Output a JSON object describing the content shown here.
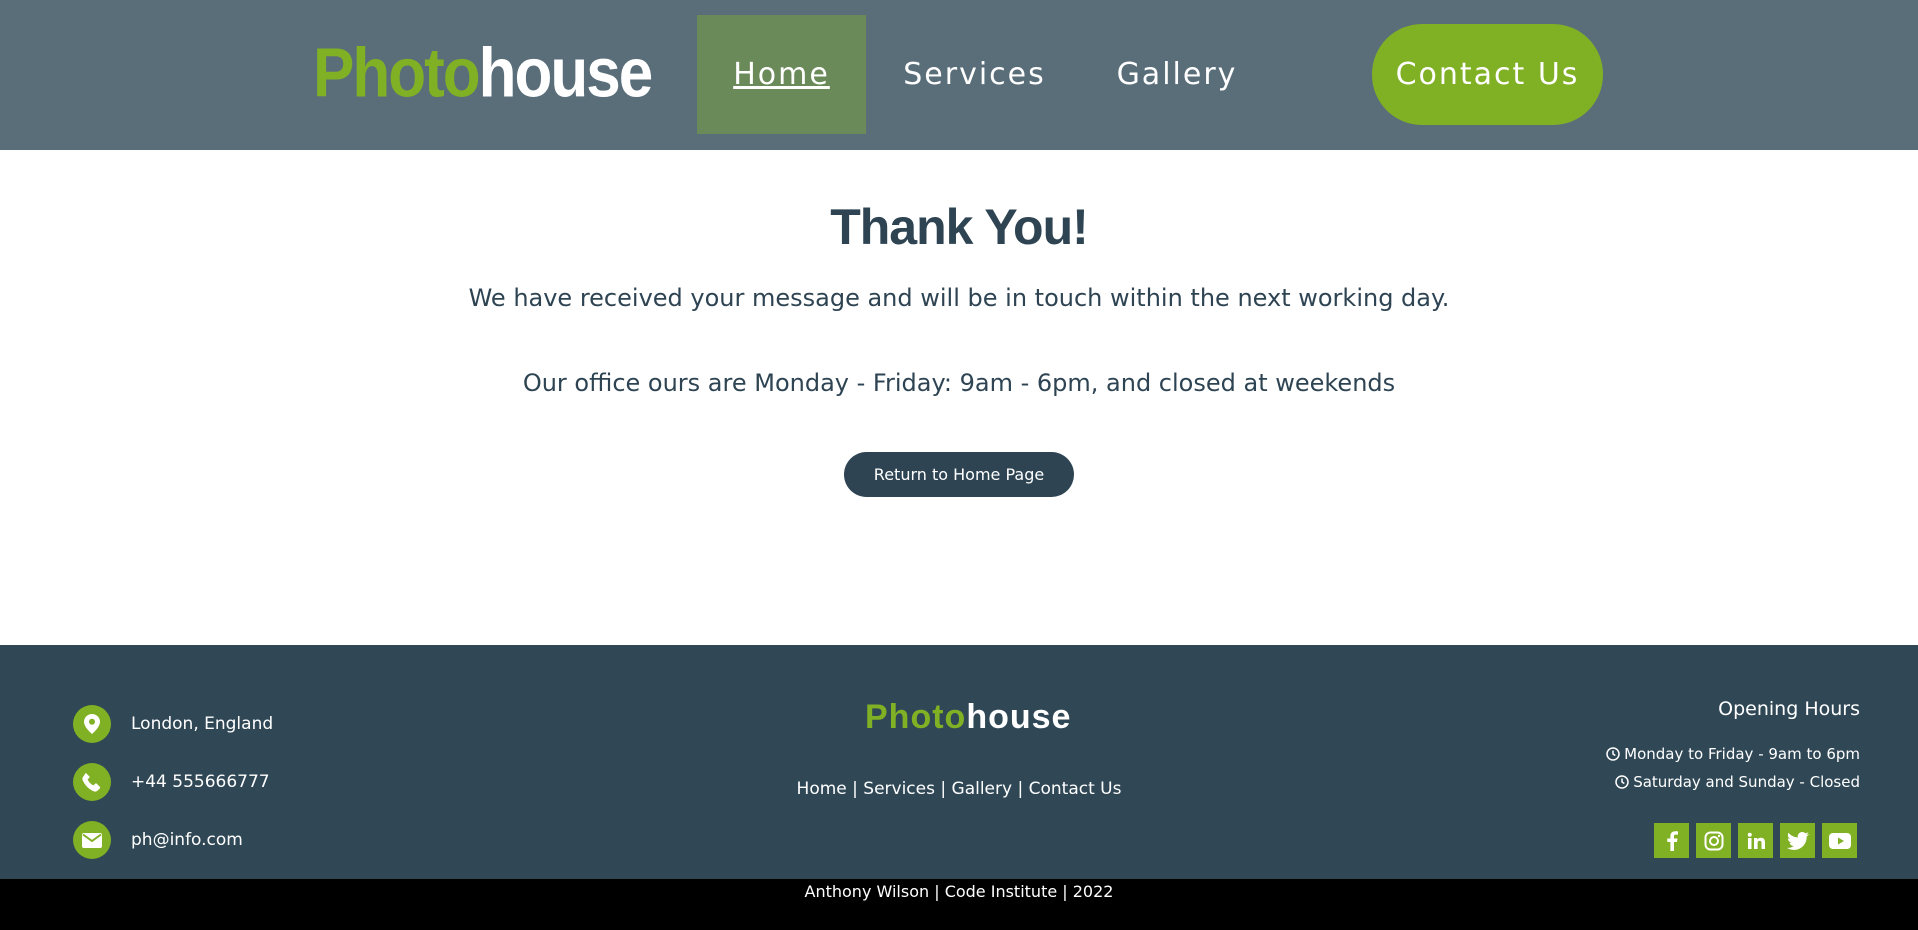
{
  "header": {
    "logo": {
      "part1": "Photo",
      "part2": "house"
    },
    "nav": [
      {
        "label": "Home"
      },
      {
        "label": "Services"
      },
      {
        "label": "Gallery"
      }
    ],
    "contact_button": "Contact Us"
  },
  "main": {
    "title": "Thank You!",
    "message1": "We have received your message and will be in touch within the next working day.",
    "message2": "Our office ours are Monday - Friday: 9am - 6pm, and closed at weekends",
    "return_button": "Return to Home Page"
  },
  "footer": {
    "contacts": [
      {
        "icon": "map-pin-icon",
        "text": "London, England"
      },
      {
        "icon": "phone-icon",
        "text": "+44 555666777"
      },
      {
        "icon": "envelope-icon",
        "text": "ph@info.com"
      }
    ],
    "logo": {
      "part1": "Photo",
      "part2": "house"
    },
    "links": [
      "Home",
      "Services",
      "Gallery",
      "Contact Us"
    ],
    "separator": " | ",
    "hours_title": "Opening Hours",
    "hours": [
      "Monday to Friday - 9am to 6pm",
      "Saturday and Sunday - Closed"
    ],
    "socials": [
      "facebook-icon",
      "instagram-icon",
      "linkedin-icon",
      "twitter-icon",
      "youtube-icon"
    ],
    "copyright": "Anthony Wilson | Code Institute | 2022"
  },
  "colors": {
    "header_bg": "#5a6e7a",
    "accent_green": "#80b024",
    "nav_active_bg": "#6b8a5a",
    "dark_slate": "#2e4453",
    "footer_bg": "#304856"
  }
}
